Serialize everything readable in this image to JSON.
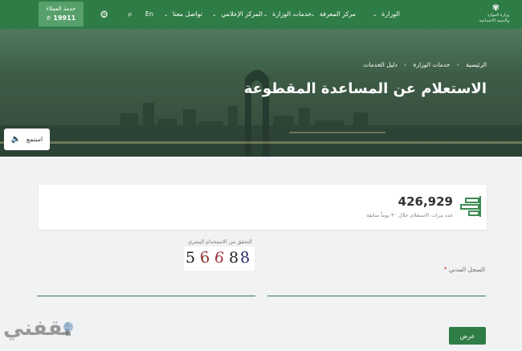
{
  "header": {
    "logo": {
      "text_line1": "وزارة الموارد",
      "text_line2": "والتنمية الاجتماعية"
    },
    "nav": [
      {
        "label": "الوزارة"
      },
      {
        "label": "مركز المعرفة"
      },
      {
        "label": "خدمات الوزارة"
      },
      {
        "label": "المركز الإعلامي"
      },
      {
        "label": "تواصل معنا"
      }
    ],
    "lang": "En",
    "icons": {
      "search": "search-icon",
      "settings": "gear-icon",
      "phone": "whatsapp-icon"
    },
    "customer_service": {
      "label": "خدمة العملاء",
      "number": "19911"
    }
  },
  "hero": {
    "breadcrumb": [
      "الرئيسية",
      "خدمات الوزارة",
      "دليل الخدمات"
    ],
    "title": "الاستعلام عن المساعدة المقطوعة",
    "listen_label": "استمع",
    "listen_icon": "speaker-icon"
  },
  "stats": {
    "value": "426,929",
    "caption": "عدد مرات الاستعلام خلال ٣٠ يوماً سابقة",
    "icon": "bar-chart-icon"
  },
  "form": {
    "captcha_label": "التحقق من الاستخدام البشري",
    "captcha_digits": [
      "5",
      "6",
      "6",
      "8",
      "8"
    ],
    "civil_registry_label": "السجل المدني",
    "required_mark": "*",
    "submit_label": "عرض"
  },
  "watermark": {
    "text": "ثقفني"
  },
  "colors": {
    "brand_green": "#2f7d46",
    "light_green": "#57a06b",
    "page_bg": "#f1f2f4"
  }
}
